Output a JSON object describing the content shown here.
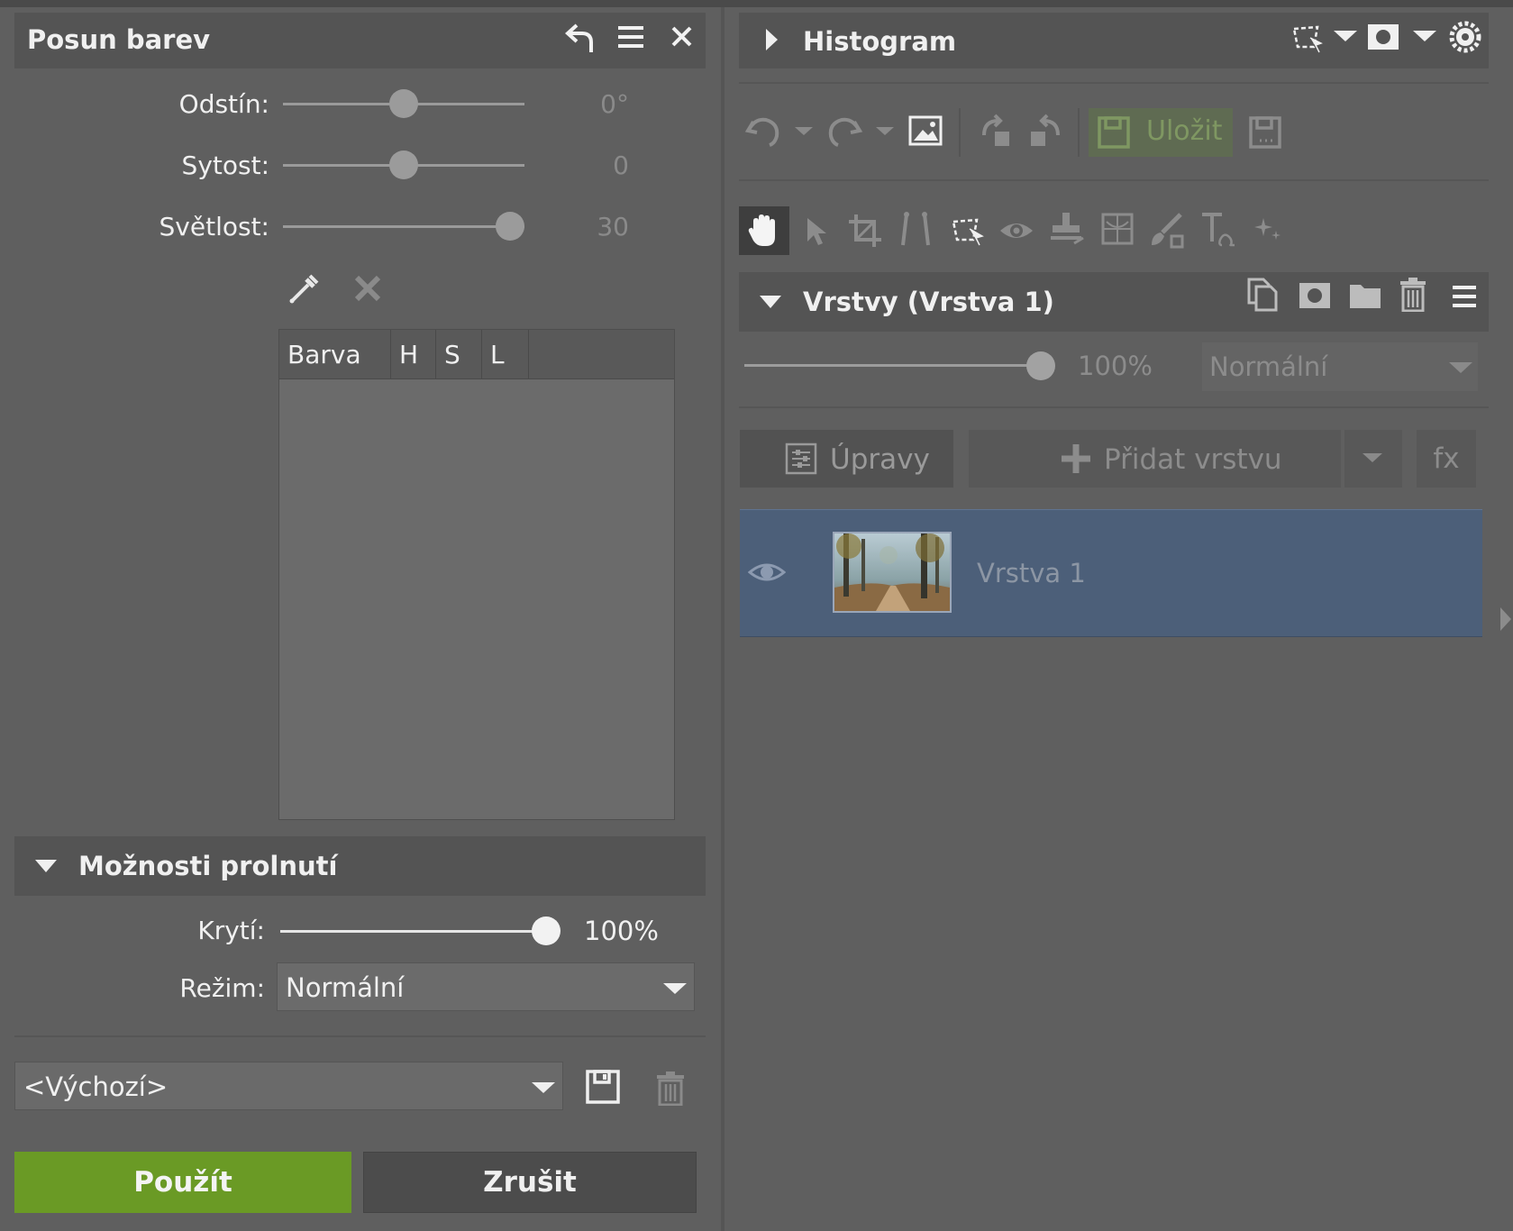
{
  "left_panel": {
    "title": "Posun barev",
    "header_icons": [
      "undo-arrow-icon",
      "hamburger-menu-icon",
      "close-icon"
    ],
    "sliders": [
      {
        "label": "Odstín:",
        "value": "0°",
        "level": 0.5
      },
      {
        "label": "Sytost:",
        "value": "0",
        "level": 0.5
      },
      {
        "label": "Světlost:",
        "value": "30",
        "level": 0.93
      }
    ],
    "tools": [
      "eyedropper-icon",
      "clear-x-icon"
    ],
    "color_table": {
      "columns": [
        "Barva",
        "H",
        "S",
        "L"
      ],
      "rows": []
    },
    "blend_section": {
      "title": "Možnosti prolnutí",
      "opacity_label": "Krytí:",
      "opacity_value": "100%",
      "opacity_level": 1.0,
      "mode_label": "Režim:",
      "mode_value": "Normální"
    },
    "preset": {
      "value": "<Výchozí>"
    },
    "apply_label": "Použít",
    "cancel_label": "Zrušit"
  },
  "right_panel": {
    "histogram_title": "Histogram",
    "toolbar_save_label": "Uložit",
    "layers_title": "Vrstvy (Vrstva 1)",
    "opacity_value": "100%",
    "blend_mode": "Normální",
    "adjustments_label": "Úpravy",
    "add_layer_label": "Přidat vrstvu",
    "fx_label": "fx",
    "layers": [
      {
        "name": "Vrstva 1",
        "visible": true
      }
    ]
  },
  "colors": {
    "accent_green": "#6a9a25",
    "selected_layer": "#4c5f79"
  }
}
